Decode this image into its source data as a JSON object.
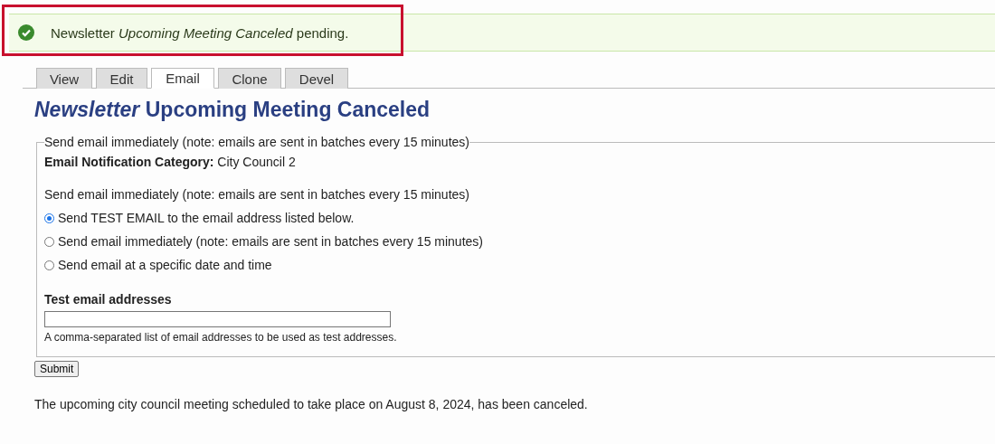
{
  "status_message": {
    "text": "Newsletter *Upcoming Meeting Canceled* pending.",
    "highlighted": true
  },
  "tabs": [
    {
      "label": "View",
      "selected": false
    },
    {
      "label": "Edit",
      "selected": false
    },
    {
      "label": "Email",
      "selected": true
    },
    {
      "label": "Clone",
      "selected": false
    },
    {
      "label": "Devel",
      "selected": false
    }
  ],
  "page_title": "*Newsletter* Upcoming Meeting Canceled",
  "fieldset": {
    "legend": "Send email immediately (note: emails are sent in batches every 15 minutes)",
    "category": {
      "label": "Email Notification Category:",
      "value": "City Council 2"
    },
    "send_description": "Send email immediately (note: emails are sent in batches every 15 minutes)",
    "options": [
      {
        "label": "Send TEST EMAIL to the email address listed below.",
        "selected": true
      },
      {
        "label": "Send email immediately (note: emails are sent in batches every 15 minutes)",
        "selected": false
      },
      {
        "label": "Send email at a specific date and time",
        "selected": false
      }
    ],
    "test_addresses": {
      "label": "Test email addresses",
      "description": "A comma-separated list of email addresses to be used as test addresses."
    }
  },
  "submit_button": "Submit",
  "body_text": "The upcoming city council meeting scheduled to take place on August 8, 2024, has been canceled."
}
